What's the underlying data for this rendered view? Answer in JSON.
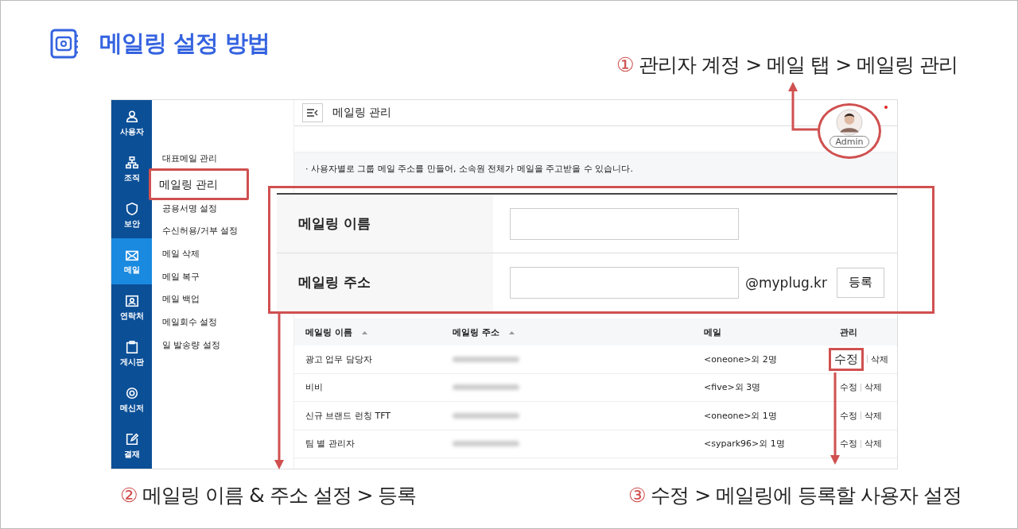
{
  "title": "메일링 설정 방법",
  "steps": [
    {
      "number": "①",
      "text": "관리자 계정 > 메일 탭 > 메일링 관리"
    },
    {
      "number": "②",
      "text": "메일링 이름 & 주소 설정 > 등록"
    },
    {
      "number": "③",
      "text": "수정 > 메일링에 등록할 사용자 설정"
    }
  ],
  "app_nav": [
    {
      "kind": "user",
      "label": "사용자",
      "selected": false
    },
    {
      "kind": "org",
      "label": "조직",
      "selected": false
    },
    {
      "kind": "shield",
      "label": "보안",
      "selected": false
    },
    {
      "kind": "mail",
      "label": "메일",
      "selected": true
    },
    {
      "kind": "contact",
      "label": "연락처",
      "selected": false
    },
    {
      "kind": "board",
      "label": "게시판",
      "selected": false
    },
    {
      "kind": "messenger",
      "label": "메신저",
      "selected": false
    },
    {
      "kind": "approval",
      "label": "결재",
      "selected": false
    }
  ],
  "submenu": [
    {
      "label": "대표메일 관리",
      "selected": false
    },
    {
      "label": "메일링 관리",
      "selected": true
    },
    {
      "label": "공용서명 설정",
      "selected": false
    },
    {
      "label": "수신허용/거부 설정",
      "selected": false
    },
    {
      "label": "메일 삭제",
      "selected": false
    },
    {
      "label": "메일 복구",
      "selected": false
    },
    {
      "label": "메일 백업",
      "selected": false
    },
    {
      "label": "메일회수 설정",
      "selected": false
    },
    {
      "label": "일 발송량 설정",
      "selected": false
    }
  ],
  "header": {
    "title": "메일링 관리",
    "user_badge": "Admin"
  },
  "notice": "· 사용자별로 그룹 메일 주소를 만들어, 소속원 전체가 메일을 주고받을 수 있습니다.",
  "form": {
    "name_label": "메일링 이름",
    "address_label": "메일링 주소",
    "domain": "@myplug.kr",
    "submit": "등록"
  },
  "table": {
    "columns": [
      {
        "label": "메일링 이름",
        "sortable": true
      },
      {
        "label": "메일링 주소",
        "sortable": true
      },
      {
        "label": "메일",
        "sortable": false
      },
      {
        "label": "관리",
        "sortable": false
      }
    ],
    "rows": [
      {
        "name": "광고 업무 담당자",
        "members": "<oneone>외 2명",
        "edit": "수정",
        "delete": "삭제",
        "highlighted": true
      },
      {
        "name": "비비",
        "members": "<five>외 3명",
        "edit": "수정",
        "delete": "삭제",
        "highlighted": false
      },
      {
        "name": "신규 브랜드 런칭 TFT",
        "members": "<oneone>외 1명",
        "edit": "수정",
        "delete": "삭제",
        "highlighted": false
      },
      {
        "name": "팀 별 관리자",
        "members": "<sypark96>외 1명",
        "edit": "수정",
        "delete": "삭제",
        "highlighted": false
      }
    ]
  }
}
